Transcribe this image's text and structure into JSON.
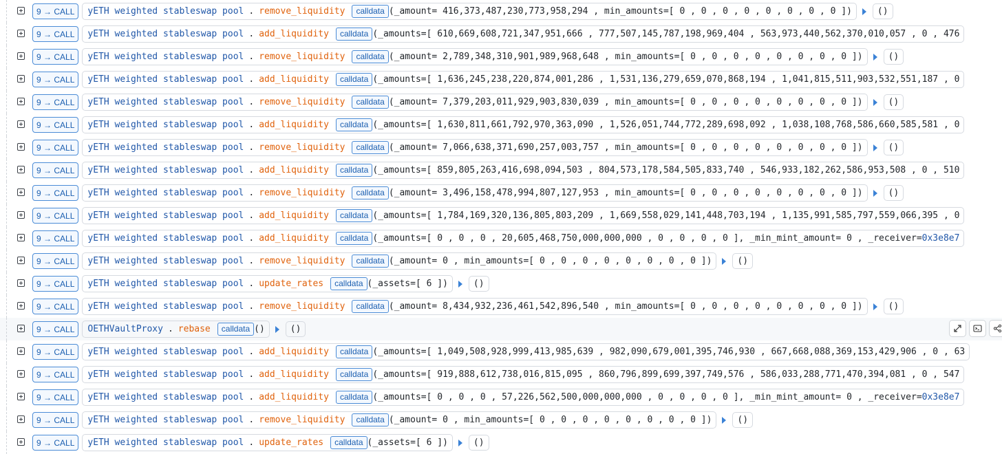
{
  "trace": {
    "rows": [
      {
        "depth": "9",
        "call_type": "CALL",
        "contract": "yETH weighted stableswap pool",
        "method": "remove_liquidity",
        "calldata_label": "calldata",
        "args": "(_amount= 416,373,487,230,773,958,294 , min_amounts=[ 0 ,  0 ,  0 ,  0 ,  0 ,  0 ,  0 ,  0 ])",
        "args_addr": "",
        "returns": "()"
      },
      {
        "depth": "9",
        "call_type": "CALL",
        "contract": "yETH weighted stableswap pool",
        "method": "add_liquidity",
        "calldata_label": "calldata",
        "args": "(_amounts=[ 610,669,608,721,347,951,666 ,  777,507,145,787,198,969,404 ,  563,973,440,562,370,010,057 ,  0 ,  476",
        "args_addr": "",
        "returns": ""
      },
      {
        "depth": "9",
        "call_type": "CALL",
        "contract": "yETH weighted stableswap pool",
        "method": "remove_liquidity",
        "calldata_label": "calldata",
        "args": "(_amount= 2,789,348,310,901,989,968,648 , min_amounts=[ 0 ,  0 ,  0 ,  0 ,  0 ,  0 ,  0 ,  0 ])",
        "args_addr": "",
        "returns": "()"
      },
      {
        "depth": "9",
        "call_type": "CALL",
        "contract": "yETH weighted stableswap pool",
        "method": "add_liquidity",
        "calldata_label": "calldata",
        "args": "(_amounts=[ 1,636,245,238,220,874,001,286 ,  1,531,136,279,659,070,868,194 ,  1,041,815,511,903,532,551,187 ,  0",
        "args_addr": "",
        "returns": ""
      },
      {
        "depth": "9",
        "call_type": "CALL",
        "contract": "yETH weighted stableswap pool",
        "method": "remove_liquidity",
        "calldata_label": "calldata",
        "args": "(_amount= 7,379,203,011,929,903,830,039 , min_amounts=[ 0 ,  0 ,  0 ,  0 ,  0 ,  0 ,  0 ,  0 ])",
        "args_addr": "",
        "returns": "()"
      },
      {
        "depth": "9",
        "call_type": "CALL",
        "contract": "yETH weighted stableswap pool",
        "method": "add_liquidity",
        "calldata_label": "calldata",
        "args": "(_amounts=[ 1,630,811,661,792,970,363,090 ,  1,526,051,744,772,289,698,092 ,  1,038,108,768,586,660,585,581 ,  0",
        "args_addr": "",
        "returns": ""
      },
      {
        "depth": "9",
        "call_type": "CALL",
        "contract": "yETH weighted stableswap pool",
        "method": "remove_liquidity",
        "calldata_label": "calldata",
        "args": "(_amount= 7,066,638,371,690,257,003,757 , min_amounts=[ 0 ,  0 ,  0 ,  0 ,  0 ,  0 ,  0 ,  0 ])",
        "args_addr": "",
        "returns": "()"
      },
      {
        "depth": "9",
        "call_type": "CALL",
        "contract": "yETH weighted stableswap pool",
        "method": "add_liquidity",
        "calldata_label": "calldata",
        "args": "(_amounts=[ 859,805,263,416,698,094,503 ,  804,573,178,584,505,833,740 ,  546,933,182,262,586,953,508 ,  0 ,  510",
        "args_addr": "",
        "returns": ""
      },
      {
        "depth": "9",
        "call_type": "CALL",
        "contract": "yETH weighted stableswap pool",
        "method": "remove_liquidity",
        "calldata_label": "calldata",
        "args": "(_amount= 3,496,158,478,994,807,127,953 , min_amounts=[ 0 ,  0 ,  0 ,  0 ,  0 ,  0 ,  0 ,  0 ])",
        "args_addr": "",
        "returns": "()"
      },
      {
        "depth": "9",
        "call_type": "CALL",
        "contract": "yETH weighted stableswap pool",
        "method": "add_liquidity",
        "calldata_label": "calldata",
        "args": "(_amounts=[ 1,784,169,320,136,805,803,209 ,  1,669,558,029,141,448,703,194 ,  1,135,991,585,797,559,066,395 ,  0",
        "args_addr": "",
        "returns": ""
      },
      {
        "depth": "9",
        "call_type": "CALL",
        "contract": "yETH weighted stableswap pool",
        "method": "add_liquidity",
        "calldata_label": "calldata",
        "args": "(_amounts=[ 0 ,  0 ,  0 ,  20,605,468,750,000,000,000 ,  0 ,  0 ,  0 ,  0 ], _min_mint_amount= 0 , _receiver= ",
        "args_addr": "0x3e8e7",
        "returns": ""
      },
      {
        "depth": "9",
        "call_type": "CALL",
        "contract": "yETH weighted stableswap pool",
        "method": "remove_liquidity",
        "calldata_label": "calldata",
        "args": "(_amount= 0 , min_amounts=[ 0 ,  0 ,  0 ,  0 ,  0 ,  0 ,  0 ,  0 ])",
        "args_addr": "",
        "returns": "()"
      },
      {
        "depth": "9",
        "call_type": "CALL",
        "contract": "yETH weighted stableswap pool",
        "method": "update_rates",
        "calldata_label": "calldata",
        "args": "(_assets=[ 6 ])",
        "args_addr": "",
        "returns": "()"
      },
      {
        "depth": "9",
        "call_type": "CALL",
        "contract": "yETH weighted stableswap pool",
        "method": "remove_liquidity",
        "calldata_label": "calldata",
        "args": "(_amount= 8,434,932,236,461,542,896,540 , min_amounts=[ 0 ,  0 ,  0 ,  0 ,  0 ,  0 ,  0 ,  0 ])",
        "args_addr": "",
        "returns": "()"
      },
      {
        "depth": "9",
        "call_type": "CALL",
        "contract": "OETHVaultProxy",
        "method": "rebase",
        "calldata_label": "calldata",
        "args": "()",
        "args_addr": "",
        "returns": "()",
        "highlighted": true
      },
      {
        "depth": "9",
        "call_type": "CALL",
        "contract": "yETH weighted stableswap pool",
        "method": "add_liquidity",
        "calldata_label": "calldata",
        "args": "(_amounts=[ 1,049,508,928,999,413,985,639 ,  982,090,679,001,395,746,930 ,  667,668,088,369,153,429,906 ,  0 ,  63",
        "args_addr": "",
        "returns": ""
      },
      {
        "depth": "9",
        "call_type": "CALL",
        "contract": "yETH weighted stableswap pool",
        "method": "add_liquidity",
        "calldata_label": "calldata",
        "args": "(_amounts=[ 919,888,612,738,016,815,095 ,  860,796,899,699,397,749,576 ,  586,033,288,771,470,394,081 ,  0 ,  547",
        "args_addr": "",
        "returns": ""
      },
      {
        "depth": "9",
        "call_type": "CALL",
        "contract": "yETH weighted stableswap pool",
        "method": "add_liquidity",
        "calldata_label": "calldata",
        "args": "(_amounts=[ 0 ,  0 ,  0 ,  57,226,562,500,000,000,000 ,  0 ,  0 ,  0 ,  0 ], _min_mint_amount= 0 , _receiver= ",
        "args_addr": "0x3e8e7",
        "returns": ""
      },
      {
        "depth": "9",
        "call_type": "CALL",
        "contract": "yETH weighted stableswap pool",
        "method": "remove_liquidity",
        "calldata_label": "calldata",
        "args": "(_amount= 0 , min_amounts=[ 0 ,  0 ,  0 ,  0 ,  0 ,  0 ,  0 ,  0 ])",
        "args_addr": "",
        "returns": "()"
      },
      {
        "depth": "9",
        "call_type": "CALL",
        "contract": "yETH weighted stableswap pool",
        "method": "update_rates",
        "calldata_label": "calldata",
        "args": "(_assets=[ 6 ])",
        "args_addr": "",
        "returns": "()"
      }
    ],
    "row_tools": [
      "expand-icon",
      "terminal-icon",
      "share-icon"
    ]
  }
}
